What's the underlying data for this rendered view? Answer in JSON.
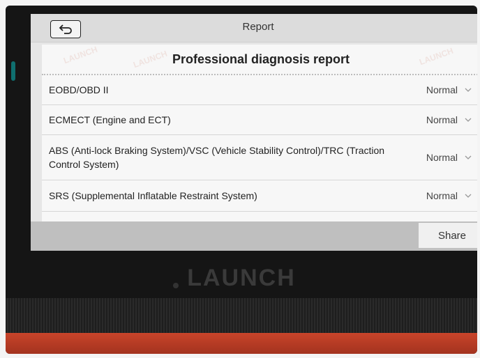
{
  "app": {
    "title": "Report"
  },
  "report": {
    "title": "Professional diagnosis report",
    "systems": [
      {
        "name": "EOBD/OBD II",
        "status": "Normal"
      },
      {
        "name": "ECMECT (Engine and ECT)",
        "status": "Normal"
      },
      {
        "name": "ABS (Anti-lock Braking System)/VSC (Vehicle Stability Control)/TRC (Traction Control System)",
        "status": "Normal"
      },
      {
        "name": "SRS (Supplemental Inflatable Restraint System)",
        "status": "Normal"
      }
    ]
  },
  "footer": {
    "share_label": "Share"
  },
  "device": {
    "brand": "LAUNCH",
    "watermark": "LAUNCH"
  },
  "icons": {
    "back": "back-arrow-icon",
    "dropdown": "chevron-down-icon"
  },
  "colors": {
    "screen_bg": "#e6e6e6",
    "card_bg": "#f7f7f7",
    "footer_bg": "#bfbfbf"
  }
}
